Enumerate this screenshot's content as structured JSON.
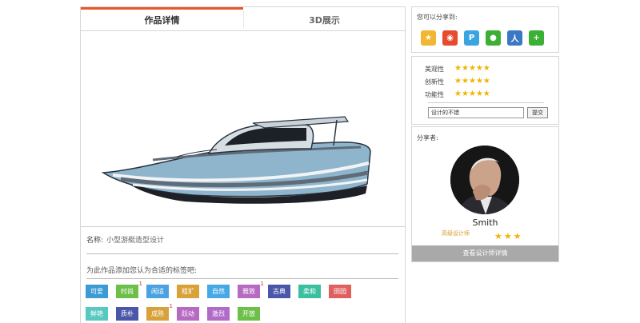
{
  "tabs": [
    {
      "label": "作品详情",
      "active": true
    },
    {
      "label": "3D展示",
      "active": false
    }
  ],
  "work": {
    "name_label": "名称:",
    "name_value": "小型游艇造型设计",
    "tag_prompt": "为此作品添加您认为合适的标签吧:"
  },
  "tags": [
    {
      "label": "可爱",
      "color": "#3c9bd4",
      "count": ""
    },
    {
      "label": "时尚",
      "color": "#6cc04a",
      "count": "1"
    },
    {
      "label": "闲适",
      "color": "#4aa2e0",
      "count": ""
    },
    {
      "label": "粗犷",
      "color": "#d8a13a",
      "count": ""
    },
    {
      "label": "自然",
      "color": "#47a8e6",
      "count": ""
    },
    {
      "label": "雅致",
      "color": "#b66ac0",
      "count": "1"
    },
    {
      "label": "古典",
      "color": "#4a56a8",
      "count": ""
    },
    {
      "label": "柔和",
      "color": "#3bbf9f",
      "count": ""
    },
    {
      "label": "田园",
      "color": "#e06060",
      "count": ""
    },
    {
      "label": "鲜艳",
      "color": "#59c8c0",
      "count": ""
    },
    {
      "label": "质朴",
      "color": "#4a56a8",
      "count": ""
    },
    {
      "label": "成熟",
      "color": "#d8a13a",
      "count": "1"
    },
    {
      "label": "跃动",
      "color": "#b66ac0",
      "count": ""
    },
    {
      "label": "激烈",
      "color": "#b06ac8",
      "count": ""
    },
    {
      "label": "开放",
      "color": "#6cc04a",
      "count": ""
    }
  ],
  "share": {
    "title": "您可以分享到:",
    "icons": [
      {
        "name": "qzone-icon",
        "glyph": "★",
        "bg": "#f2b632"
      },
      {
        "name": "weibo-icon",
        "glyph": "◉",
        "bg": "#e8492f"
      },
      {
        "name": "tencent-weibo-icon",
        "glyph": "P",
        "bg": "#39a4e0"
      },
      {
        "name": "wechat-icon",
        "glyph": "●",
        "bg": "#3cb035"
      },
      {
        "name": "renren-icon",
        "glyph": "人",
        "bg": "#3a77c4"
      },
      {
        "name": "more-icon",
        "glyph": "+",
        "bg": "#3cb035"
      }
    ]
  },
  "ratings": [
    {
      "label": "美观性",
      "stars": 5
    },
    {
      "label": "创新性",
      "stars": 5
    },
    {
      "label": "功能性",
      "stars": 5
    }
  ],
  "comment": {
    "value": "设计的不错",
    "submit_label": "提交"
  },
  "sharer": {
    "label": "分享者:",
    "name": "Smith",
    "title": "高级设计师",
    "stars": 3,
    "detail_button": "查看设计师详情"
  }
}
